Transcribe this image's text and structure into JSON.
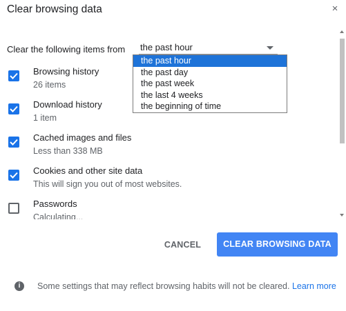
{
  "dialog": {
    "title": "Clear browsing data",
    "close_label": "×"
  },
  "time_range": {
    "label": "Clear the following items from",
    "selected": "the past hour",
    "options": [
      "the past hour",
      "the past day",
      "the past week",
      "the last 4 weeks",
      "the beginning of time"
    ]
  },
  "items": [
    {
      "title": "Browsing history",
      "subtitle": "26 items",
      "checked": true
    },
    {
      "title": "Download history",
      "subtitle": "1 item",
      "checked": true
    },
    {
      "title": "Cached images and files",
      "subtitle": "Less than 338 MB",
      "checked": true
    },
    {
      "title": "Cookies and other site data",
      "subtitle": "This will sign you out of most websites.",
      "checked": true
    },
    {
      "title": "Passwords",
      "subtitle": "Calculating...",
      "checked": false
    }
  ],
  "buttons": {
    "cancel": "CANCEL",
    "clear": "CLEAR BROWSING DATA"
  },
  "footer": {
    "text": "Some settings that may reflect browsing habits will not be cleared.",
    "link": "Learn more"
  },
  "colors": {
    "accent": "#4285f4",
    "checkbox": "#1a73e8",
    "selected_option": "#1e73d8"
  }
}
